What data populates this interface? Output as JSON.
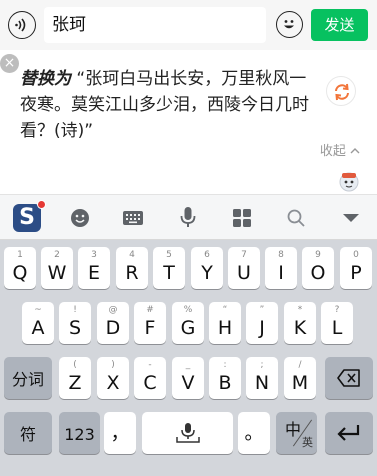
{
  "input_bar": {
    "voice_icon": "voice-icon",
    "text_value": "张珂",
    "emoji_icon": "smiley-icon",
    "send_label": "发送"
  },
  "suggestion": {
    "close_icon": "close-icon",
    "prefix": "替换为",
    "text": " “张珂白马出长安，万里秋风一夜寒。莫笑江山多少泪，西陵今日几时看？(诗)”",
    "refresh_icon": "refresh-icon",
    "collapse_label": "收起",
    "collapse_icon": "chevron-up-icon"
  },
  "mascot_icon": "mascot-icon",
  "toolbar": {
    "logo_label": "S",
    "items": [
      "sogou-logo",
      "emoji-icon",
      "keyboard-icon",
      "microphone-icon",
      "apps-icon",
      "search-icon",
      "hide-keyboard-icon"
    ]
  },
  "keyboard": {
    "row1": [
      {
        "key": "Q",
        "hint": "1"
      },
      {
        "key": "W",
        "hint": "2"
      },
      {
        "key": "E",
        "hint": "3"
      },
      {
        "key": "R",
        "hint": "4"
      },
      {
        "key": "T",
        "hint": "5"
      },
      {
        "key": "Y",
        "hint": "6"
      },
      {
        "key": "U",
        "hint": "7"
      },
      {
        "key": "I",
        "hint": "8"
      },
      {
        "key": "O",
        "hint": "9"
      },
      {
        "key": "P",
        "hint": "0"
      }
    ],
    "row2": [
      {
        "key": "A",
        "hint": "~"
      },
      {
        "key": "S",
        "hint": "!"
      },
      {
        "key": "D",
        "hint": "@"
      },
      {
        "key": "F",
        "hint": "#"
      },
      {
        "key": "G",
        "hint": "%"
      },
      {
        "key": "H",
        "hint": "“"
      },
      {
        "key": "J",
        "hint": "”"
      },
      {
        "key": "K",
        "hint": "*"
      },
      {
        "key": "L",
        "hint": "?"
      }
    ],
    "row3": [
      {
        "key": "Z",
        "hint": "("
      },
      {
        "key": "X",
        "hint": ")"
      },
      {
        "key": "C",
        "hint": "-"
      },
      {
        "key": "V",
        "hint": "_"
      },
      {
        "key": "B",
        "hint": ":"
      },
      {
        "key": "N",
        "hint": ";"
      },
      {
        "key": "M",
        "hint": "/"
      }
    ],
    "fenci_label": "分词",
    "delete_icon": "backspace-icon",
    "symbol_label": "符",
    "num_label": "123",
    "comma_label": "，",
    "space_icon": "space-mic-icon",
    "period_label": "。",
    "lang_big": "中",
    "lang_small": "英",
    "enter_icon": "return-icon"
  }
}
